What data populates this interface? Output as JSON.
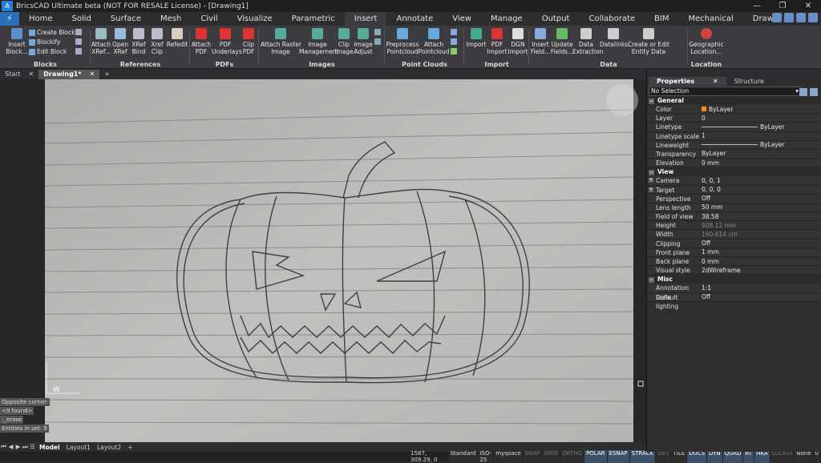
{
  "window": {
    "title": "BricsCAD Ultimate beta (NOT FOR RESALE License) - [Drawing1]",
    "logo": "A",
    "buttons": [
      "—",
      "❐",
      "✕"
    ]
  },
  "ribbon_tabs": [
    "Home",
    "Solid",
    "Surface",
    "Mesh",
    "Civil",
    "Visualize",
    "Parametric",
    "Insert",
    "Annotate",
    "View",
    "Manage",
    "Output",
    "Collaborate",
    "BIM",
    "Mechanical",
    "Draw"
  ],
  "active_ribbon_tab": "Insert",
  "ribbon": {
    "blocks": {
      "label": "Blocks",
      "insert": "Insert\nBlock...",
      "create": "Create Block",
      "blockify": "Blockify",
      "edit": "Edit Block"
    },
    "references": {
      "label": "References",
      "attach": "Attach\nXRef...",
      "open": "Open\nXRef",
      "bind": "XRef\nBind",
      "clip": "Xref\nClip",
      "refedit": "Refedit"
    },
    "pdfs": {
      "label": "PDFs",
      "attach": "Attach\nPDF",
      "underlays": "PDF\nUnderlays",
      "clip": "Clip\nPDF"
    },
    "images": {
      "label": "Images",
      "attach": "Attach Raster\nImage",
      "manage": "Image\nManagement",
      "clip": "Clip\nImage",
      "adjust": "Image\nAdjust"
    },
    "pointclouds": {
      "label": "Point Clouds",
      "preprocess": "Preprocess\nPointcloud",
      "attach": "Attach\nPointcloud"
    },
    "import": {
      "label": "Import",
      "import": "Import",
      "pdf": "PDF\nImport",
      "dgn": "DGN\nImport"
    },
    "data": {
      "label": "Data",
      "insert_field": "Insert\nField...",
      "update": "Update\nFields...",
      "extraction": "Data\nExtraction",
      "datalinks": "Datalinks...",
      "entity": "Create or Edit\nEntity Data"
    },
    "location": {
      "label": "Location",
      "geo": "Geographic\nLocation..."
    }
  },
  "doc_tabs": [
    {
      "label": "Start",
      "close": "✕"
    },
    {
      "label": "Drawing1*",
      "close": "✕"
    }
  ],
  "doc_tab_add": "+",
  "command_lines": [
    "Opposite corner:",
    "<9 found>",
    ":_erase",
    "Entities in set: 9"
  ],
  "ucs_label": "W",
  "layout_tabs": [
    "Model",
    "Layout1",
    "Layout2",
    "+"
  ],
  "layout_nav": [
    "⏮",
    "◀",
    "▶",
    "⏭",
    "☰"
  ],
  "status": {
    "coords": "1587, 309.29, 0",
    "items": [
      {
        "t": "Standard",
        "s": "n"
      },
      {
        "t": "ISO-25",
        "s": "n"
      },
      {
        "t": "myspace",
        "s": "n"
      },
      {
        "t": "SNAP",
        "s": "off"
      },
      {
        "t": "GRID",
        "s": "off"
      },
      {
        "t": "ORTHO",
        "s": "off"
      },
      {
        "t": "POLAR",
        "s": "on"
      },
      {
        "t": "ESNAP",
        "s": "on"
      },
      {
        "t": "STRACK",
        "s": "on"
      },
      {
        "t": "LWT",
        "s": "off"
      },
      {
        "t": "TILE",
        "s": "n"
      },
      {
        "t": "DUCS",
        "s": "on"
      },
      {
        "t": "DYN",
        "s": "on"
      },
      {
        "t": "QUAD",
        "s": "on"
      },
      {
        "t": "RT",
        "s": "on"
      },
      {
        "t": "HKA",
        "s": "on"
      },
      {
        "t": "LOCKUI",
        "s": "off"
      },
      {
        "t": "None",
        "s": "n"
      },
      {
        "t": "0",
        "s": "n"
      }
    ]
  },
  "panel": {
    "tabs": [
      "Properties",
      "Structure"
    ],
    "tab_close": "✕",
    "selection": "No Selection",
    "sections": [
      {
        "title": "General",
        "rows": [
          {
            "k": "Color",
            "v": "ByLayer",
            "swatch": true
          },
          {
            "k": "Layer",
            "v": "0"
          },
          {
            "k": "Linetype",
            "v": "ByLayer",
            "line": true
          },
          {
            "k": "Linetype scale",
            "v": "1"
          },
          {
            "k": "Lineweight",
            "v": "ByLayer",
            "line": true
          },
          {
            "k": "Transparency",
            "v": "ByLayer"
          },
          {
            "k": "Elevation",
            "v": "0 mm"
          }
        ]
      },
      {
        "title": "View",
        "rows": [
          {
            "k": "Camera",
            "v": "0, 0, 1",
            "exp": true
          },
          {
            "k": "Target",
            "v": "0, 0, 0",
            "exp": true
          },
          {
            "k": "Perspective",
            "v": "Off"
          },
          {
            "k": "Lens length",
            "v": "50 mm"
          },
          {
            "k": "Field of view",
            "v": "38.58"
          },
          {
            "k": "Height",
            "v": "908.11 mm",
            "dim": true
          },
          {
            "k": "Width",
            "v": "160.614 cm",
            "dim": true
          },
          {
            "k": "Clipping",
            "v": "Off"
          },
          {
            "k": "Front plane",
            "v": "1 mm"
          },
          {
            "k": "Back plane",
            "v": "0 mm"
          },
          {
            "k": "Visual style",
            "v": "2dWireframe"
          }
        ]
      },
      {
        "title": "Misc",
        "rows": [
          {
            "k": "Annotation scale",
            "v": "1:1"
          },
          {
            "k": "Default lighting",
            "v": "Off"
          }
        ]
      }
    ]
  }
}
